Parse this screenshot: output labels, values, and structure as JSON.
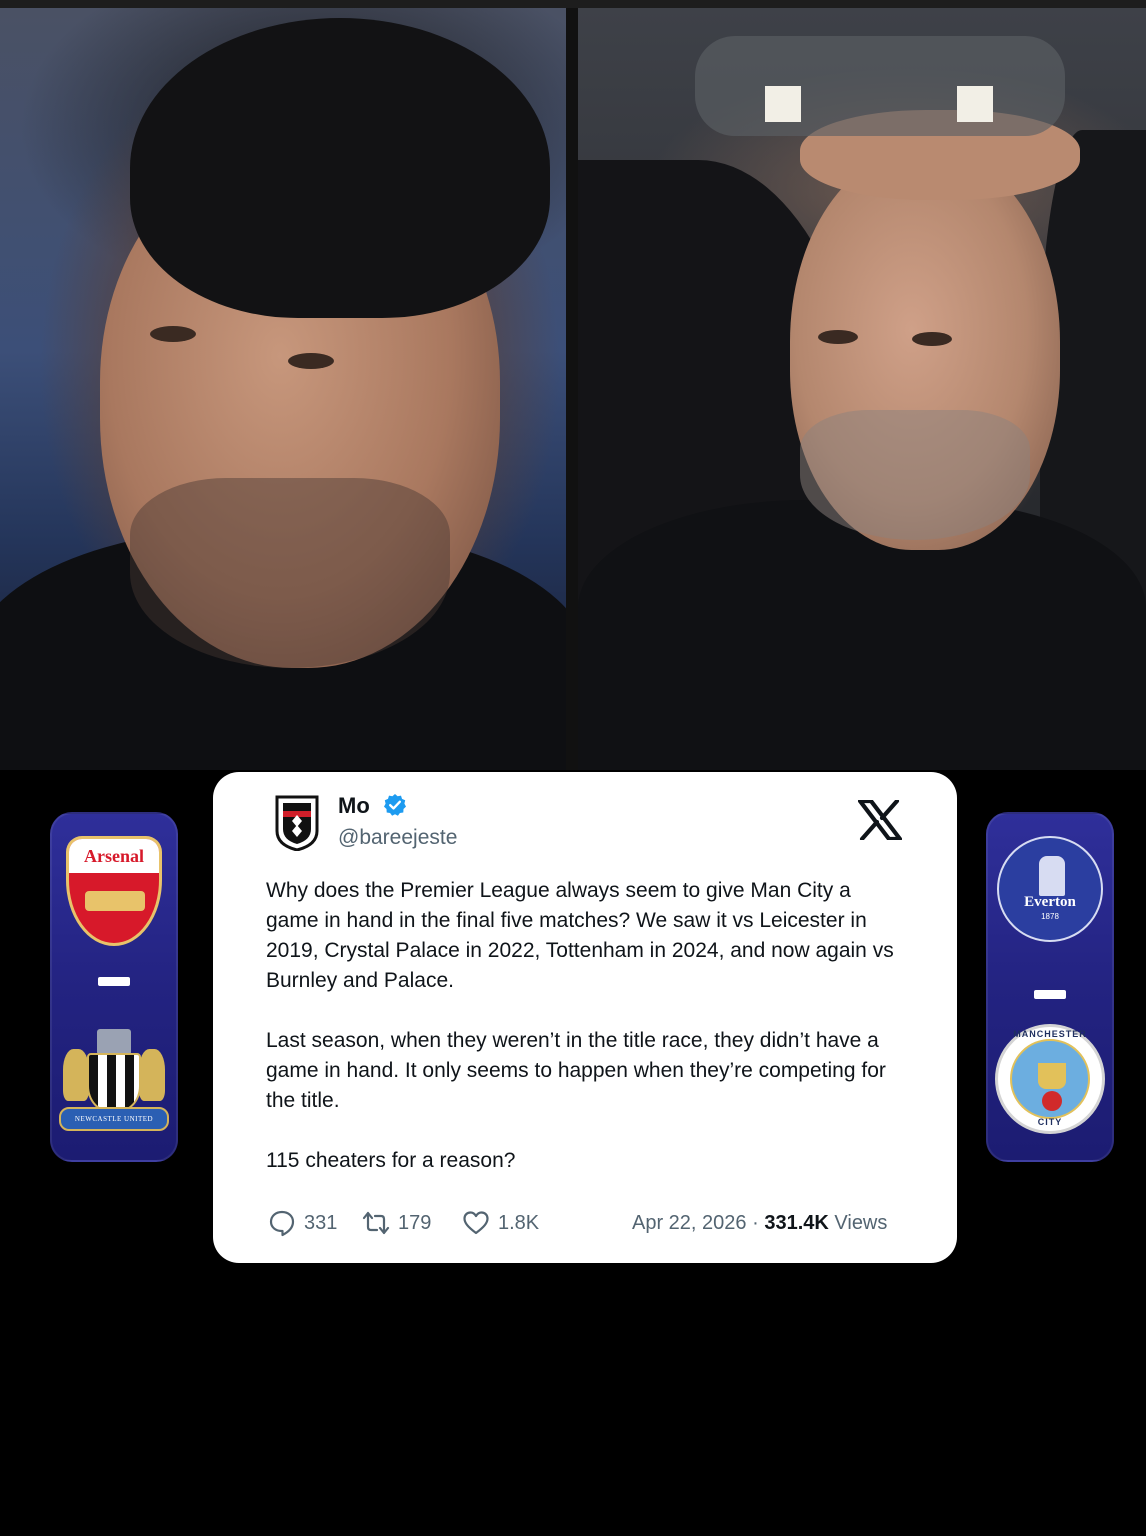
{
  "tweet": {
    "display_name": "Mo",
    "handle": "@bareejeste",
    "body": [
      "Why does the Premier League always seem to give Man City a game in hand in the final five matches? We saw it vs Leicester in 2019, Crystal Palace in 2022, Tottenham in 2024, and now again vs Burnley and Palace.",
      "Last season, when they weren’t in the title race, they didn’t have a game in hand. It only seems to happen when they’re competing for the title.",
      "115 cheaters for a reason?"
    ],
    "replies": "331",
    "reposts": "179",
    "likes": "1.8K",
    "date": "Apr 22, 2026",
    "separator": "·",
    "views_count": "331.4K",
    "views_label": "Views"
  },
  "clubs": {
    "left_top": "Arsenal",
    "left_bottom_scroll": "NEWCASTLE UNITED",
    "right_top": "Everton",
    "right_top_year": "1878",
    "right_bottom_top_text": "MANCHESTER",
    "right_bottom_bottom_text": "CITY"
  },
  "icons": {
    "verified": "verified-badge-icon",
    "x_logo": "x-logo-icon",
    "reply": "reply-icon",
    "repost": "repost-icon",
    "like": "heart-icon"
  },
  "colors": {
    "card_bg": "#ffffff",
    "verified_blue": "#1d9bf0",
    "muted_text": "#536471",
    "club_card": "#232381"
  }
}
